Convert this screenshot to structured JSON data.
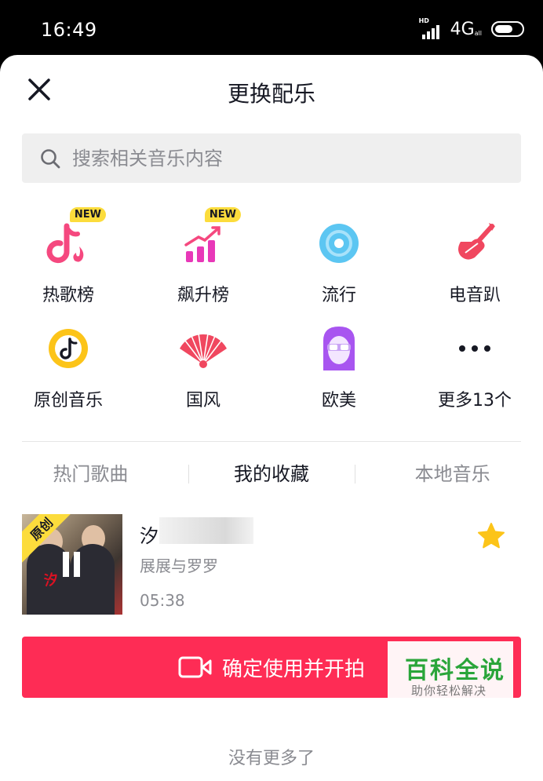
{
  "status": {
    "time": "16:49",
    "hd": "HD",
    "network": "4G",
    "network_sub": "all"
  },
  "sheet": {
    "title": "更换配乐"
  },
  "search": {
    "placeholder": "搜索相关音乐内容"
  },
  "categories": [
    {
      "label": "热歌榜",
      "icon": "hot-chart-icon",
      "badge": "NEW"
    },
    {
      "label": "飙升榜",
      "icon": "rising-chart-icon",
      "badge": "NEW"
    },
    {
      "label": "流行",
      "icon": "vinyl-disc-icon"
    },
    {
      "label": "电音趴",
      "icon": "electric-guitar-icon"
    },
    {
      "label": "原创音乐",
      "icon": "original-music-icon"
    },
    {
      "label": "国风",
      "icon": "folding-fan-icon"
    },
    {
      "label": "欧美",
      "icon": "western-face-icon"
    },
    {
      "label": "更多13个",
      "icon": "more-dots-icon"
    }
  ],
  "tabs": [
    {
      "label": "热门歌曲",
      "active": false
    },
    {
      "label": "我的收藏",
      "active": true
    },
    {
      "label": "本地音乐",
      "active": false
    }
  ],
  "song": {
    "tag": "原创",
    "title": "汐",
    "artist": "展展与罗罗",
    "duration": "05:38",
    "favorited": true,
    "cover_text": "汐"
  },
  "confirm": {
    "label": "确定使用并开拍"
  },
  "footer": {
    "no_more": "没有更多了"
  },
  "watermark": {
    "main": "百科全说",
    "sub": "助你轻松解决"
  },
  "colors": {
    "accent": "#fe2c55",
    "badge": "#fcdc3c",
    "star": "#fcc419",
    "pink": "#f5487f"
  }
}
